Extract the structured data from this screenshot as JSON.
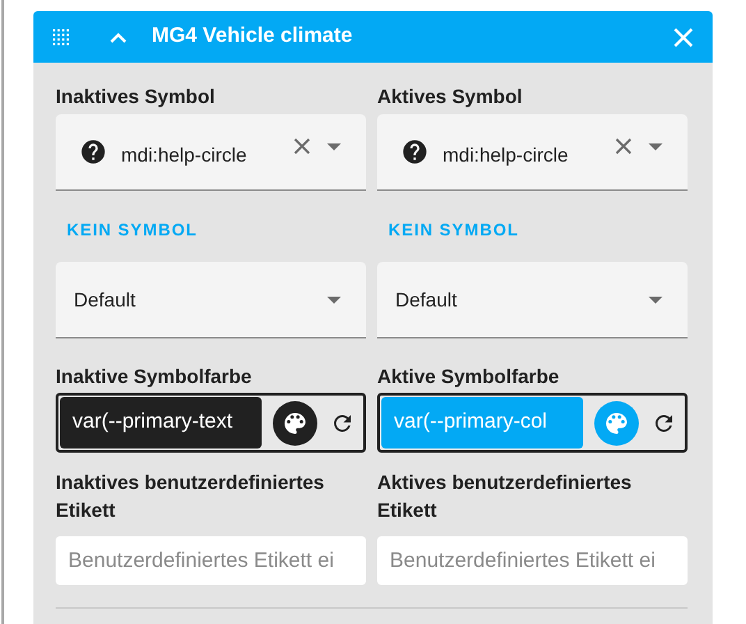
{
  "header": {
    "title": "MG4 Vehicle climate",
    "expanded": true
  },
  "columns": [
    {
      "icon_label": "Inaktives Symbol",
      "icon_value": "mdi:help-circle",
      "no_icon_button": "KEIN SYMBOL",
      "style_value": "Default",
      "color_label": "Inaktive Symbolfarbe",
      "color_value": "var(--primary-text",
      "color": "#212121",
      "custom_label_title": "Inaktives benutzerdefiniertes Etikett",
      "custom_label_placeholder": "Benutzerdefiniertes Etikett ei"
    },
    {
      "icon_label": "Aktives Symbol",
      "icon_value": "mdi:help-circle",
      "no_icon_button": "KEIN SYMBOL",
      "style_value": "Default",
      "color_label": "Aktive Symbolfarbe",
      "color_value": "var(--primary-col",
      "color": "#03a9f4",
      "custom_label_title": "Aktives benutzerdefiniertes Etikett",
      "custom_label_placeholder": "Benutzerdefiniertes Etikett ei"
    }
  ]
}
